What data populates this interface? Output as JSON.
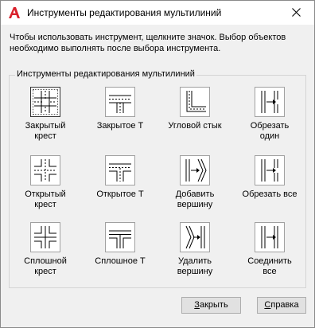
{
  "window": {
    "title": "Инструменты редактирования мультилиний",
    "app_icon": "autocad-a-icon",
    "close_icon": "close-icon"
  },
  "instructions": {
    "line1": "Чтобы использовать инструмент, щелкните значок. Выбор объектов",
    "line2": "необходимо выполнять после выбора инструмента."
  },
  "group": {
    "label": "Инструменты редактирования мультилиний"
  },
  "tools": [
    {
      "label": "Закрытый крест",
      "label_line1": "Закрытый",
      "label_line2": "крест",
      "icon": "closed-cross-icon"
    },
    {
      "label": "Закрытое Т",
      "label_line1": "Закрытое Т",
      "label_line2": "",
      "icon": "closed-tee-icon"
    },
    {
      "label": "Угловой стык",
      "label_line1": "Угловой стык",
      "label_line2": "",
      "icon": "corner-joint-icon"
    },
    {
      "label": "Обрезать один",
      "label_line1": "Обрезать",
      "label_line2": "один",
      "icon": "cut-single-icon"
    },
    {
      "label": "Открытый крест",
      "label_line1": "Открытый",
      "label_line2": "крест",
      "icon": "open-cross-icon"
    },
    {
      "label": "Открытое Т",
      "label_line1": "Открытое Т",
      "label_line2": "",
      "icon": "open-tee-icon"
    },
    {
      "label": "Добавить вершину",
      "label_line1": "Добавить",
      "label_line2": "вершину",
      "icon": "add-vertex-icon"
    },
    {
      "label": "Обрезать все",
      "label_line1": "Обрезать все",
      "label_line2": "",
      "icon": "cut-all-icon"
    },
    {
      "label": "Сплошной крест",
      "label_line1": "Сплошной",
      "label_line2": "крест",
      "icon": "merged-cross-icon"
    },
    {
      "label": "Сплошное Т",
      "label_line1": "Сплошное Т",
      "label_line2": "",
      "icon": "merged-tee-icon"
    },
    {
      "label": "Удалить вершину",
      "label_line1": "Удалить",
      "label_line2": "вершину",
      "icon": "delete-vertex-icon"
    },
    {
      "label": "Соединить все",
      "label_line1": "Соединить",
      "label_line2": "все",
      "icon": "weld-all-icon"
    }
  ],
  "buttons": {
    "close_prefix": "",
    "close_mnemonic": "З",
    "close_rest": "акрыть",
    "help_prefix": "",
    "help_mnemonic": "С",
    "help_rest": "правка"
  },
  "colors": {
    "app_icon_red": "#d9212c",
    "dialog_bg": "#f0f0f0",
    "button_bg": "#e1e1e1"
  }
}
